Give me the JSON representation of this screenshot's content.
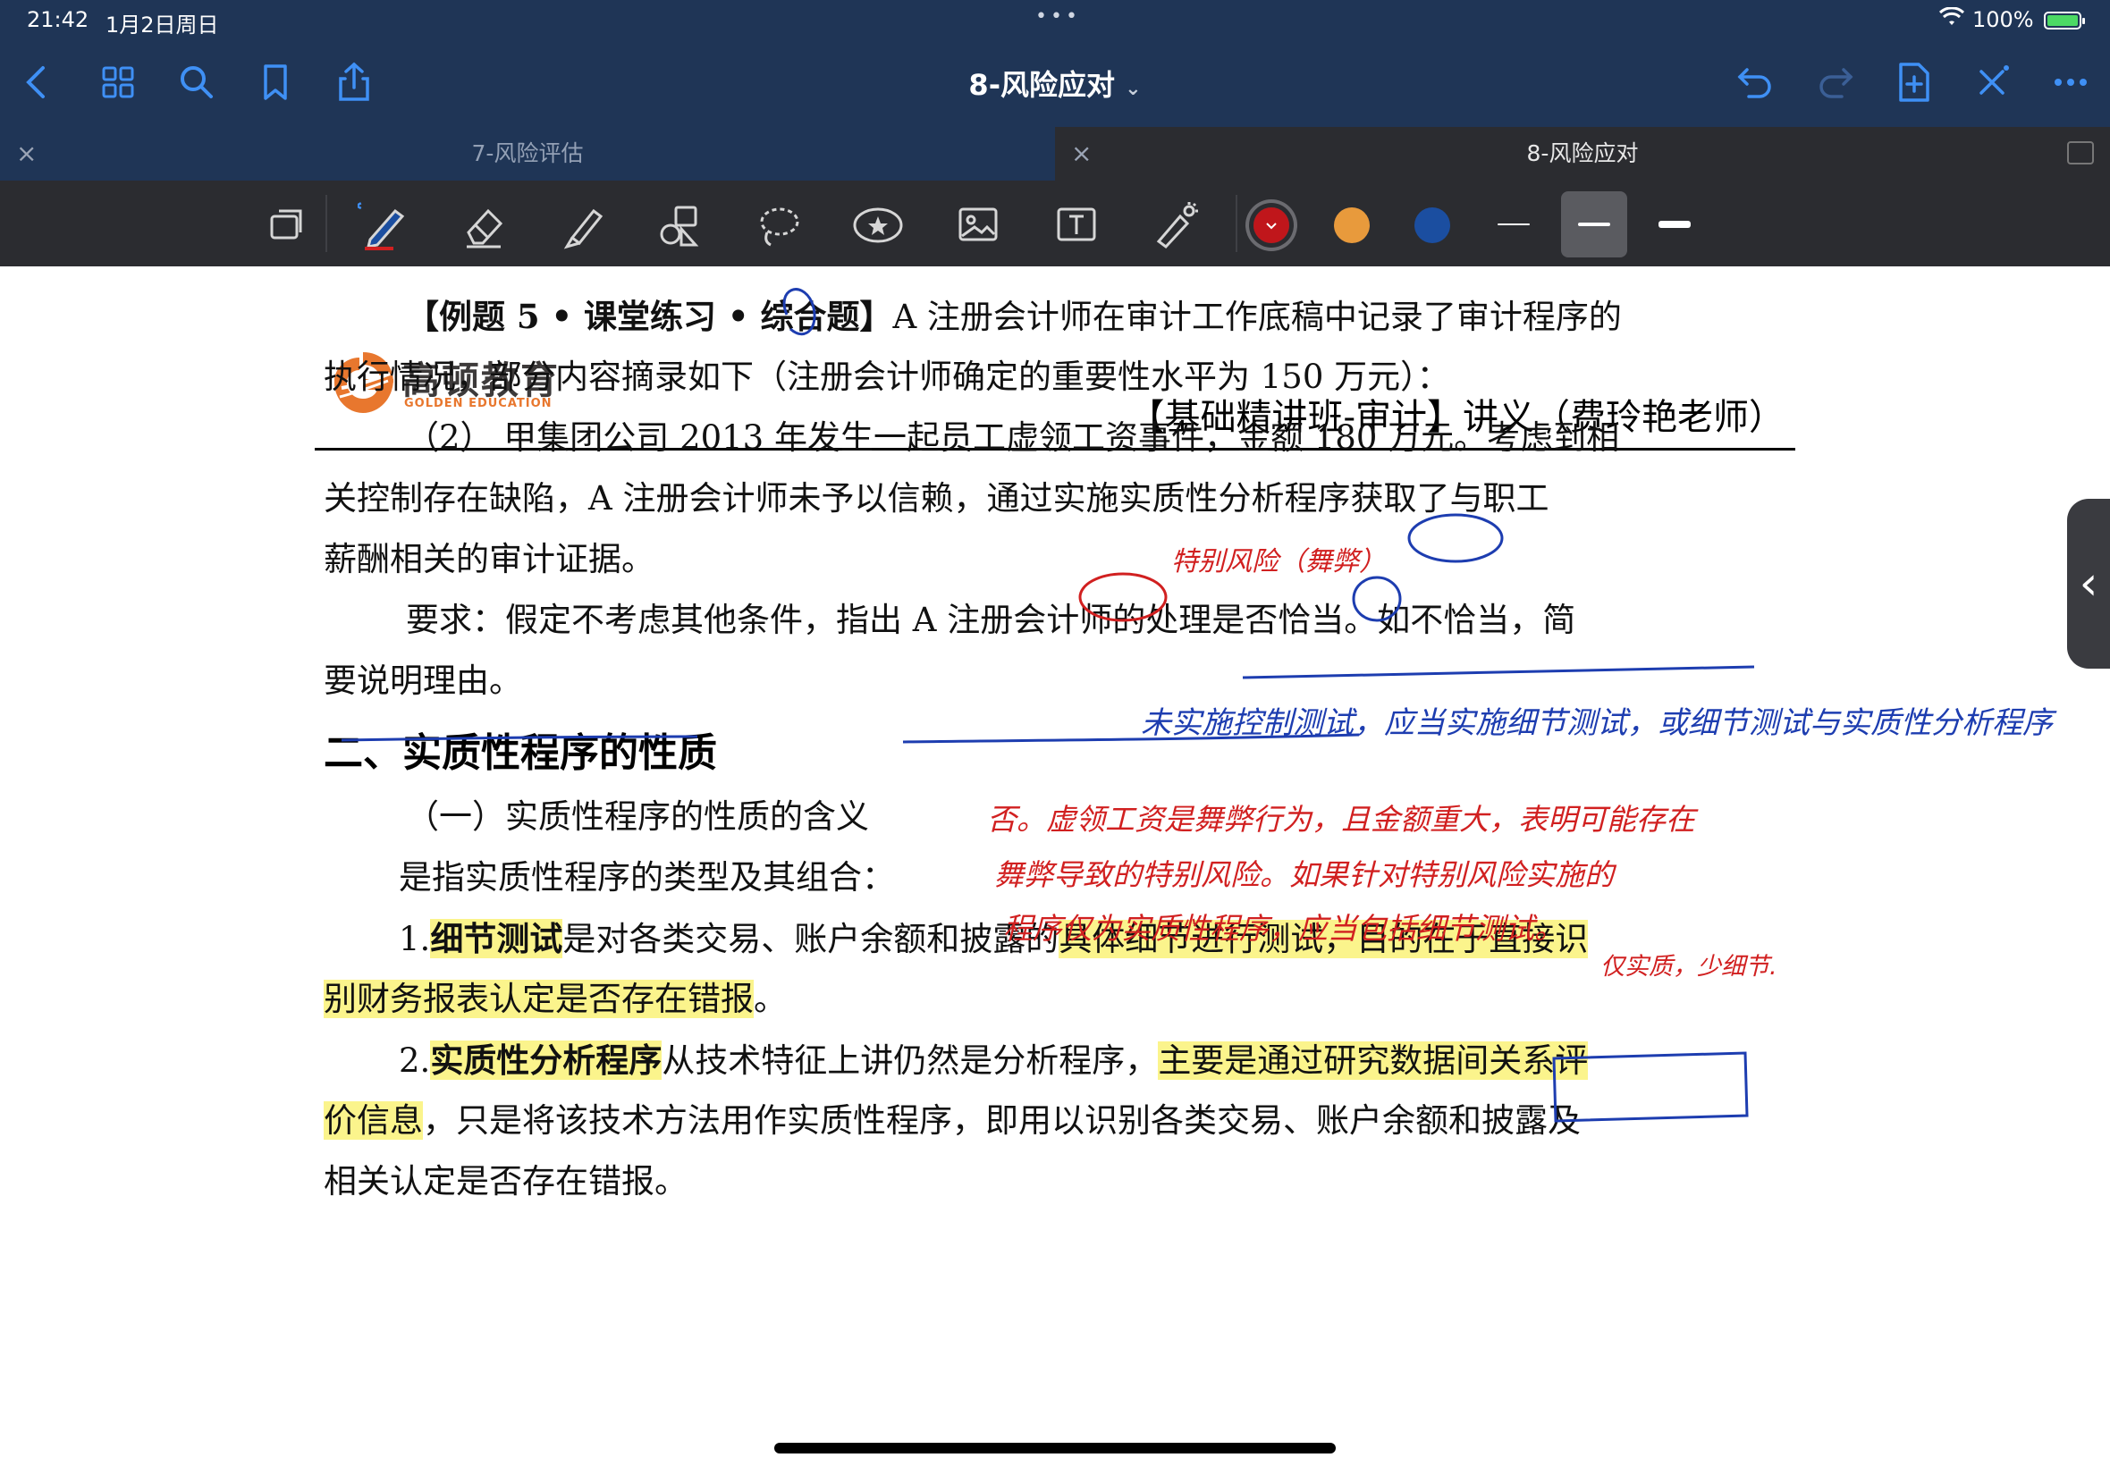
{
  "status_bar": {
    "time": "21:42",
    "date": "1月2日周日",
    "battery": "100%"
  },
  "nav": {
    "title": "8-风险应对",
    "icons": [
      "back-icon",
      "grid-icon",
      "search-icon",
      "bookmark-icon",
      "share-icon",
      "undo-icon",
      "redo-icon",
      "add-page-icon",
      "close-x-icon",
      "more-icon"
    ]
  },
  "tabs": [
    {
      "label": "7-风险评估",
      "active": false
    },
    {
      "label": "8-风险应对",
      "active": true
    }
  ],
  "toolbar": {
    "colors": [
      "#c0161b",
      "#e89a3c",
      "#1b4ea0"
    ],
    "selected_color": "#c0161b"
  },
  "document": {
    "logo_cn": "高顿教育",
    "logo_en": "GOLDEN EDUCATION",
    "header": "【基础精讲班-审计】讲义（费玲艳老师）",
    "example": {
      "line1_bold": "【例题 5 • 课堂练习 • 综合题】",
      "line1_rest": "A 注册会计师在审计工作底稿中记录了审计程序的",
      "line2": "执行情况，部分内容摘录如下（注册会计师确定的重要性水平为 150 万元）：",
      "line3": "（2）  甲集团公司 2013 年发生一起员工虚领工资事件，金额 180 万元。考虑到相",
      "line4": "关控制存在缺陷，A 注册会计师未予以信赖，通过实施实质性分析程序获取了与职工",
      "line5": "薪酬相关的审计证据。",
      "line6": "要求：假定不考虑其他条件，指出 A 注册会计师的处理是否恰当。如不恰当，简",
      "line7": "要说明理由。"
    },
    "section_title": "二、实质性程序的性质",
    "sub_title": "（一）实质性程序的性质的含义",
    "intro": "是指实质性程序的类型及其组合：",
    "item1": {
      "num": "1.",
      "bold": "细节测试",
      "mid1": "是对各类交易、账户余额和披露的",
      "hl": "具体细节进行测试，目的在于直接识",
      "line2": "别财务报表认定是否存在错报",
      "end": "。"
    },
    "item2": {
      "num": "2.",
      "bold": "实质性分析程序",
      "mid1": "从技术特征上讲仍然是分析程序，",
      "hl": "主要是通过研究数据间关系评",
      "line2_hl": "价信息",
      "line2_rest": "，只是将该技术方法用作实质性程序，即用以识别各类交易、账户余额和披露及",
      "line3": "相关认定是否存在错报。"
    }
  },
  "annotations": {
    "red_top": "特别风险（舞弊）",
    "blue_note": "未实施控制测试，应当实施细节测试，或细节测试与实质性分析程序",
    "red_answer_1": "否。虚领工资是舞弊行为，且金额重大，表明可能存在",
    "red_answer_2": "舞弊导致的特别风险。如果针对特别风险实施的",
    "red_answer_3": "程序仅为实质性程序，应当包括细节测试。",
    "red_answer_4": "仅实质，少细节."
  }
}
